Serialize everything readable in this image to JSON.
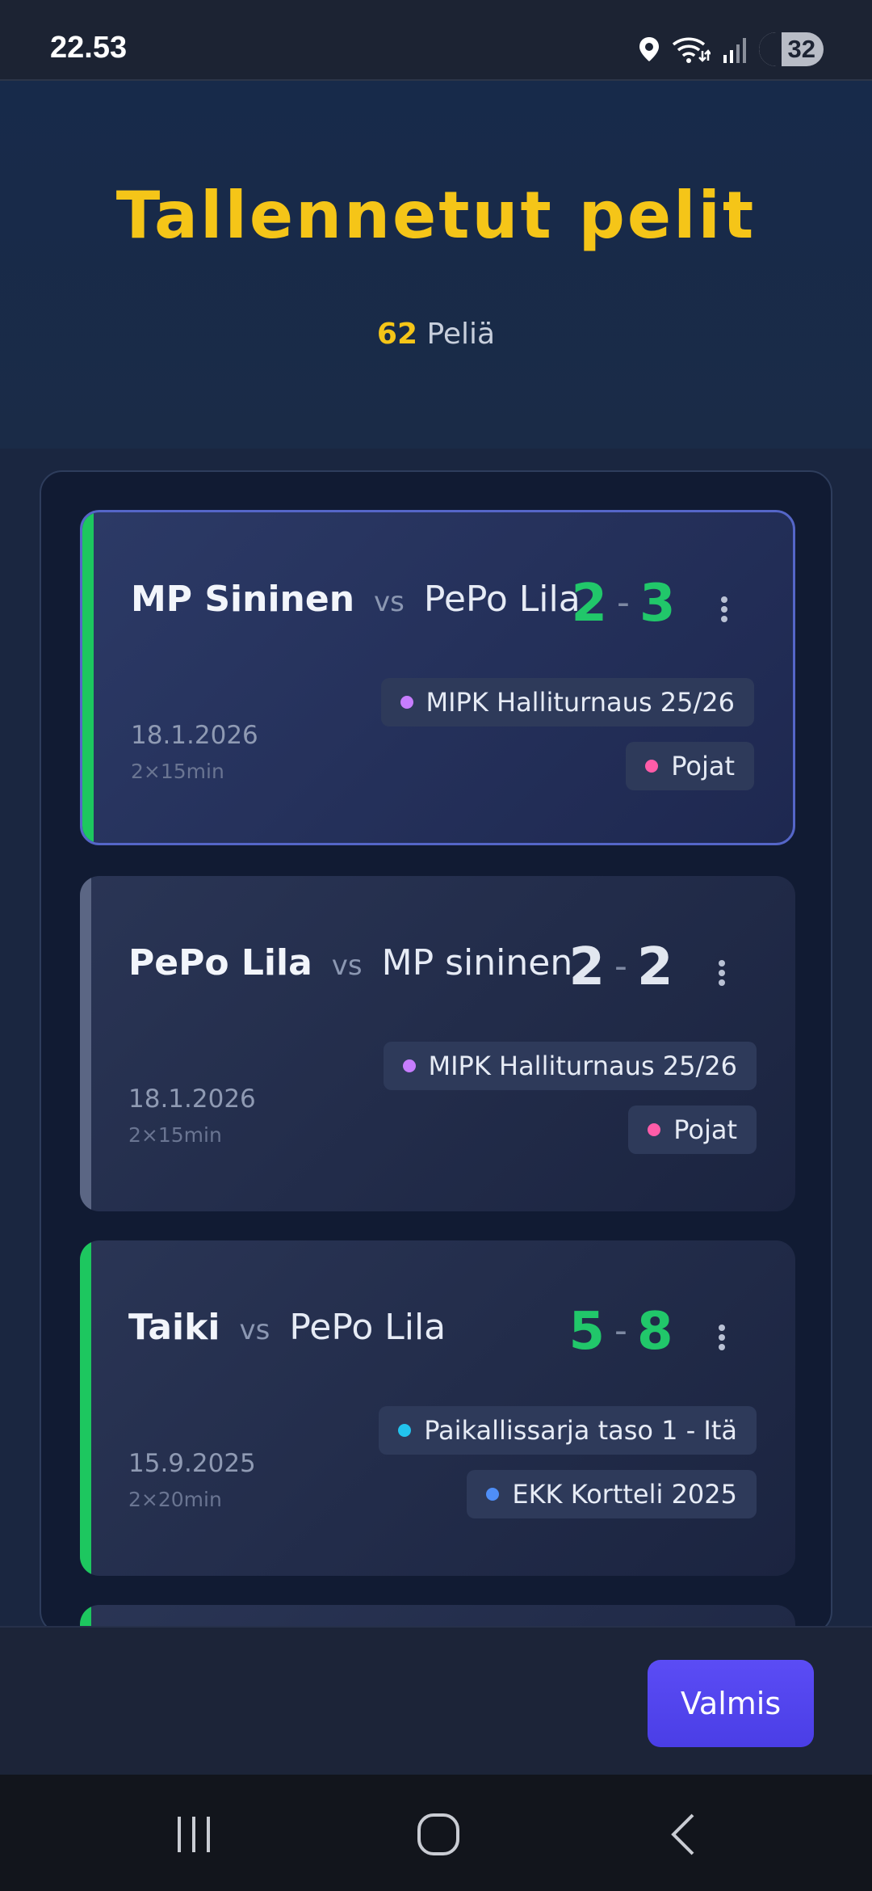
{
  "status_bar": {
    "time": "22.53",
    "battery": "32",
    "icons": [
      "location-icon",
      "wifi-icon",
      "signal-icon",
      "battery-icon"
    ]
  },
  "header": {
    "title": "Tallennetut pelit",
    "count": "62",
    "count_label": "Peliä"
  },
  "games": [
    {
      "home": "MP Sininen",
      "vs": "vs",
      "away": "PePo Lila",
      "score_home": "2",
      "score_away": "3",
      "date": "18.1.2026",
      "duration": "2×15min",
      "tags": [
        {
          "label": "MIPK Halliturnaus 25/26",
          "color": "#c77dff"
        },
        {
          "label": "Pojat",
          "color": "#ff5ca8"
        }
      ],
      "result_color": "#21c76a"
    },
    {
      "home": "PePo Lila",
      "vs": "vs",
      "away": "MP sininen",
      "score_home": "2",
      "score_away": "2",
      "date": "18.1.2026",
      "duration": "2×15min",
      "tags": [
        {
          "label": "MIPK Halliturnaus 25/26",
          "color": "#c77dff"
        },
        {
          "label": "Pojat",
          "color": "#ff5ca8"
        }
      ],
      "result_color": "#e2e7f0"
    },
    {
      "home": "Taiki",
      "vs": "vs",
      "away": "PePo Lila",
      "score_home": "5",
      "score_away": "8",
      "date": "15.9.2025",
      "duration": "2×20min",
      "tags": [
        {
          "label": "Paikallissarja taso 1 - Itä",
          "color": "#22c4ee"
        },
        {
          "label": "EKK Kortteli 2025",
          "color": "#4f8ef7"
        }
      ],
      "result_color": "#21c76a"
    }
  ],
  "actions": {
    "done_label": "Valmis"
  },
  "colors": {
    "accent_yellow": "#f5c518",
    "win_green": "#1dc75f",
    "primary_button": "#5b4cf5"
  }
}
